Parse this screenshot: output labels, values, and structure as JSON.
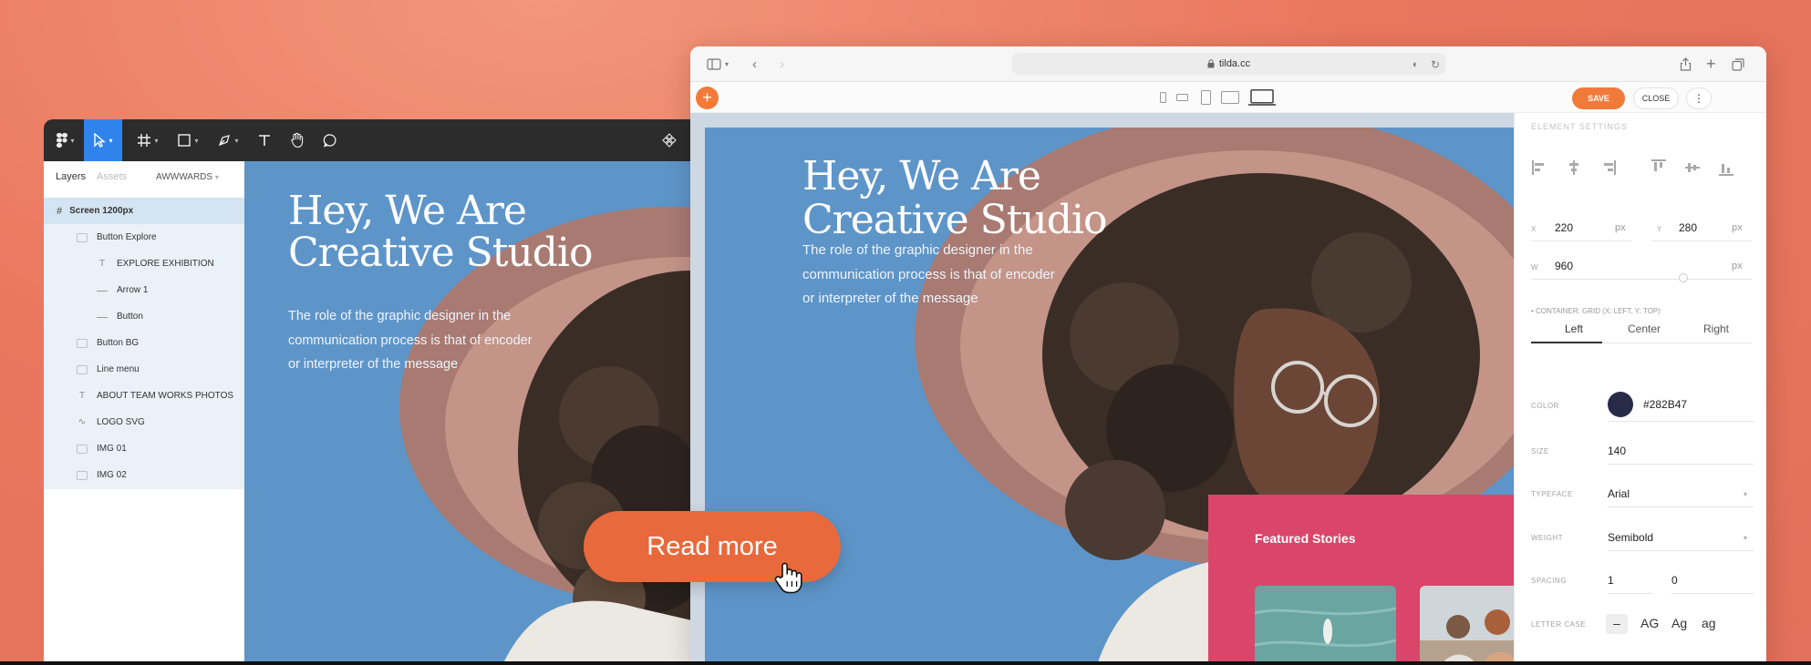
{
  "figma": {
    "tabs": [
      "Layers",
      "Assets"
    ],
    "page": "AWWWARDS",
    "layers": [
      {
        "label": "Screen 1200px",
        "icon": "frame-icon"
      },
      {
        "label": "Button Explore",
        "icon": "rect-icon"
      },
      {
        "label": "EXPLORE EXHIBITION",
        "icon": "text-icon"
      },
      {
        "label": "Arrow 1",
        "icon": "line-icon"
      },
      {
        "label": "Button",
        "icon": "line-icon"
      },
      {
        "label": "Button BG",
        "icon": "rect-icon"
      },
      {
        "label": "Line menu",
        "icon": "rect-icon"
      },
      {
        "label": "ABOUT TEAM WORKS PHOTOS",
        "icon": "text-icon"
      },
      {
        "label": "LOGO SVG",
        "icon": "vector-icon"
      },
      {
        "label": "IMG 01",
        "icon": "image-icon"
      },
      {
        "label": "IMG 02",
        "icon": "image-icon"
      }
    ]
  },
  "hero": {
    "title_line1": "Hey, We Are",
    "title_line2": "Creative Studio",
    "sub_line1": "The role of the graphic designer in the",
    "sub_line2": "communication process is that of encoder",
    "sub_line3": "or interpreter of the message"
  },
  "browser": {
    "url": "tilda.cc",
    "save": "SAVE",
    "close": "CLOSE",
    "more": "⋮"
  },
  "featured": {
    "title": "Featured Stories"
  },
  "panel": {
    "header": "ELEMENT SETTINGS",
    "x_label": "X",
    "x_value": "220",
    "x_unit": "px",
    "y_label": "Y",
    "y_value": "280",
    "y_unit": "px",
    "w_label": "W",
    "w_value": "960",
    "w_unit": "px",
    "container_hint": "• CONTAINER: GRID (X: LEFT, Y: TOP)",
    "align_tabs": [
      "Left",
      "Center",
      "Right"
    ],
    "color_label": "COLOR",
    "color_value": "#282B47",
    "size_label": "SIZE",
    "size_value": "140",
    "typeface_label": "TYPEFACE",
    "typeface_value": "Arial",
    "weight_label": "WEIGHT",
    "weight_value": "Semibold",
    "spacing_label": "SPACING",
    "spacing_value1": "1",
    "spacing_value2": "0",
    "case_label": "LETTER CASE",
    "case_options": [
      "–",
      "AG",
      "Ag",
      "ag"
    ]
  },
  "cta": {
    "label": "Read more"
  },
  "colors": {
    "accent": "#f17a3a",
    "hero_bg": "#5e95c9",
    "featured_bg": "#d9466a",
    "text_color": "#282B47"
  }
}
